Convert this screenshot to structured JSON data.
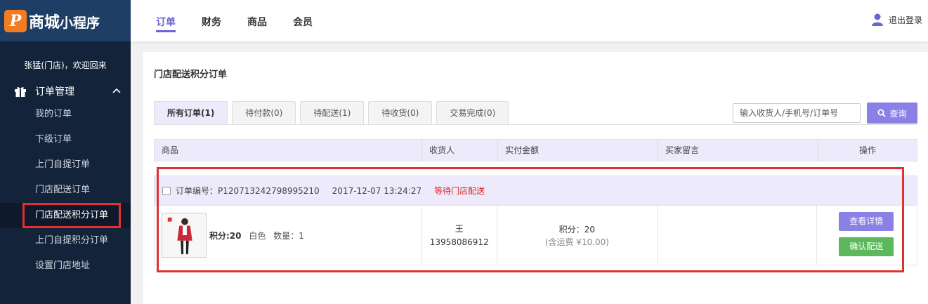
{
  "logo": {
    "badge": "P",
    "text_main": "商城",
    "text_sub": "小程序"
  },
  "topnav": {
    "tabs": [
      "订单",
      "财务",
      "商品",
      "会员"
    ],
    "active_index": 0,
    "logout_label": "退出登录"
  },
  "sidebar": {
    "welcome": "张猛(门店)，欢迎回来",
    "group_label": "订单管理",
    "items": [
      "我的订单",
      "下级订单",
      "上门自提订单",
      "门店配送订单",
      "门店配送积分订单",
      "上门自提积分订单",
      "设置门店地址"
    ],
    "active_index": 4
  },
  "page": {
    "title": "门店配送积分订单",
    "tabs": [
      "所有订单(1)",
      "待付款(0)",
      "待配送(1)",
      "待收货(0)",
      "交易完成(0)"
    ],
    "active_tab": 0,
    "search_placeholder": "输入收货人/手机号/订单号",
    "search_button": "查询"
  },
  "table": {
    "columns": [
      "商品",
      "收货人",
      "实付金额",
      "买家留言",
      "操作"
    ]
  },
  "order": {
    "number_label": "订单编号：P120713242798995210",
    "date": "2017-12-07 13:24:27",
    "status": "等待门店配送",
    "goods_points": "积分:20",
    "goods_color": "白色",
    "goods_qty": "数量：1",
    "receiver_name": "王",
    "receiver_phone": "13958086912",
    "amount": "积分：20",
    "shipping": "(含运费 ¥10.00)",
    "note": "",
    "btn_detail": "查看详情",
    "btn_confirm": "确认配送"
  },
  "colors": {
    "accent": "#6b63d8",
    "button_purple": "#8b80e6",
    "button_green": "#5cb85c",
    "status_red": "#e02020",
    "sidebar_bg": "#13233a",
    "logo_bg": "#1e3e66"
  }
}
